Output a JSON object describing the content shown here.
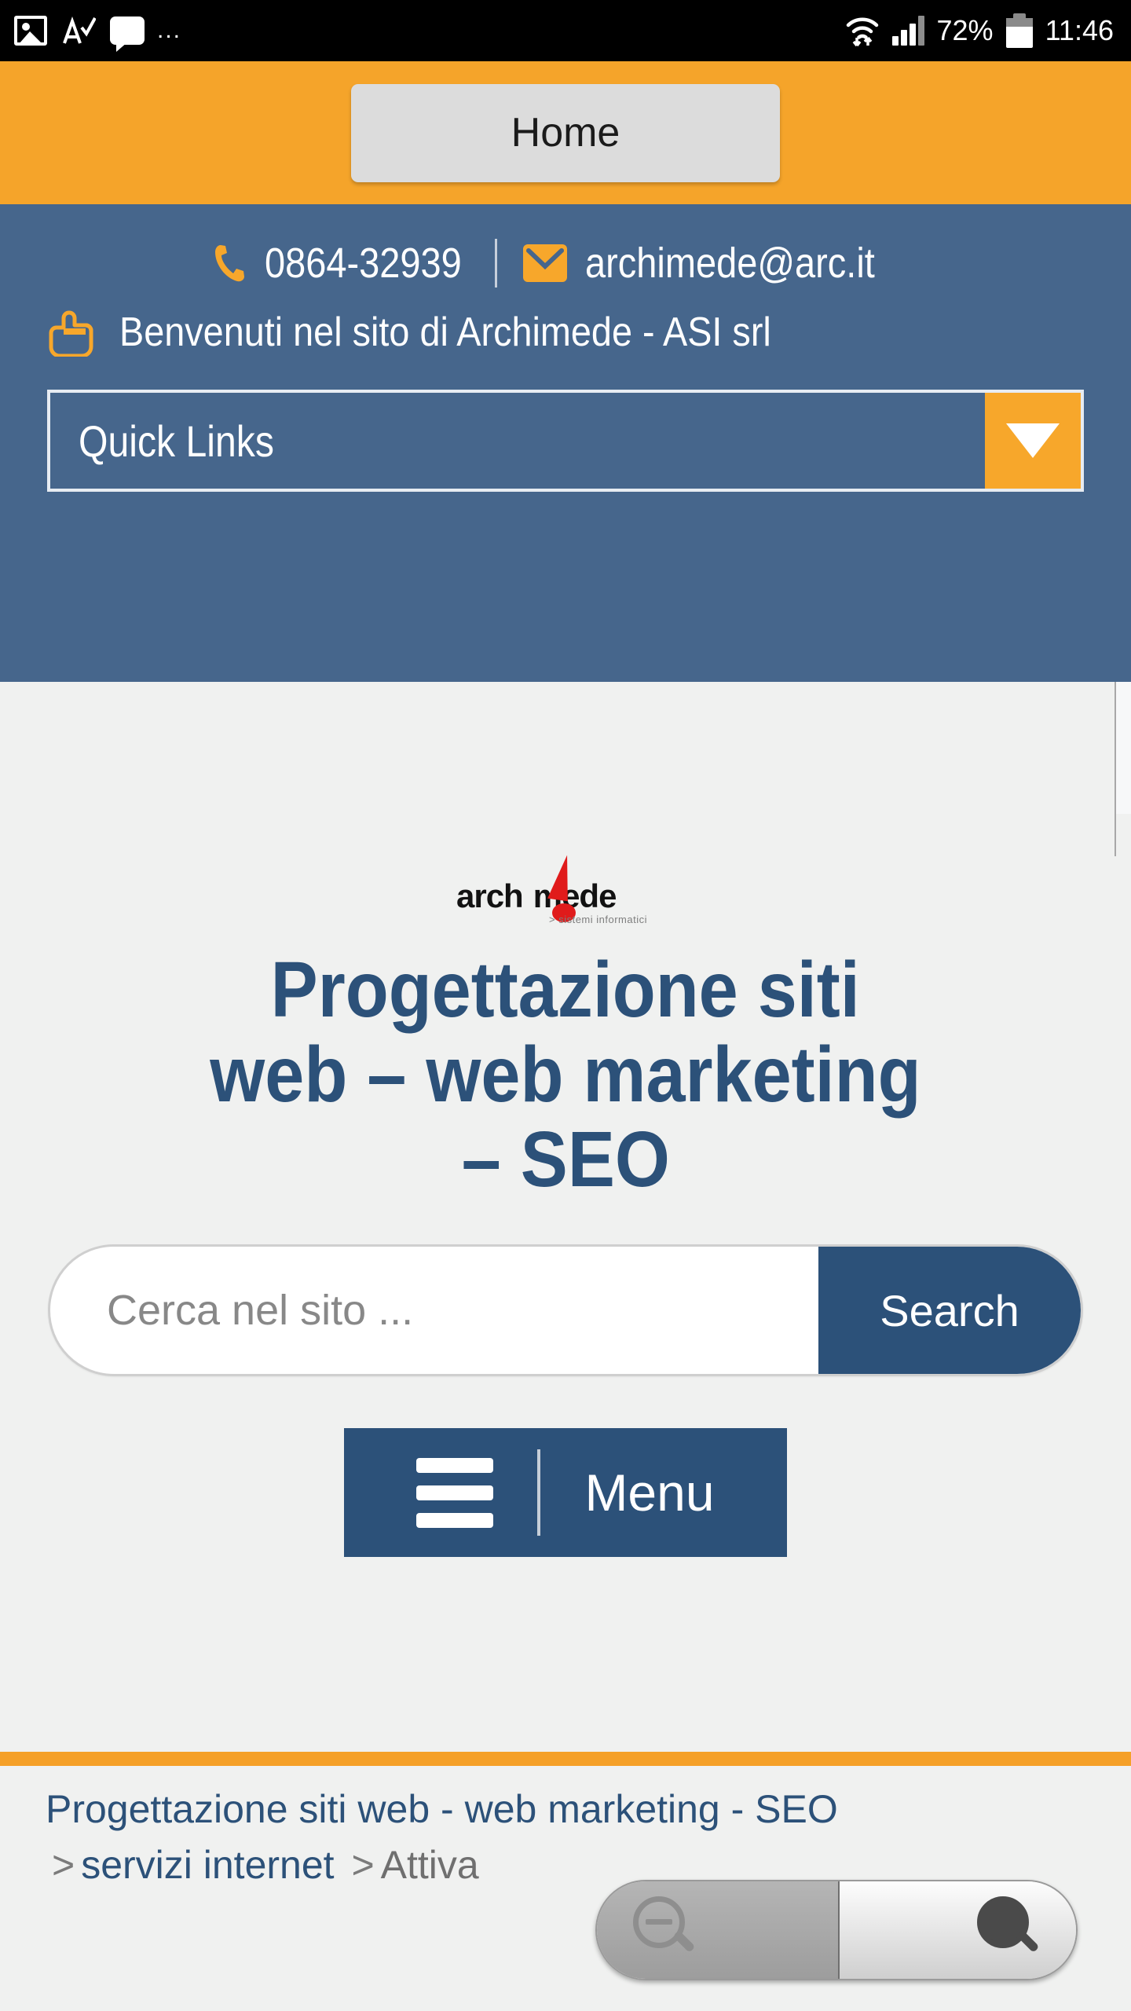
{
  "statusbar": {
    "icons": [
      "image-icon",
      "spellcheck-icon",
      "chat-icon"
    ],
    "overflow_dots": "...",
    "battery_percent": "72%",
    "time": "11:46"
  },
  "topbar": {
    "home_label": "Home"
  },
  "header": {
    "phone": "0864-32939",
    "email": "archimede@arc.it",
    "welcome": "Benvenuti nel sito di Archimede - ASI srl",
    "quick_links_label": "Quick Links"
  },
  "logo": {
    "word_left": "arch",
    "word_right": "mede",
    "tagline": "> sistemi  informatici"
  },
  "main": {
    "title_line1": "Progettazione siti",
    "title_line2": "web – web marketing",
    "title_line3": "– SEO",
    "search_placeholder": "Cerca nel sito ...",
    "search_value": "",
    "search_button": "Search",
    "menu_label": "Menu"
  },
  "breadcrumb": {
    "home": "Progettazione siti web - web marketing - SEO",
    "sep": ">",
    "level2": "servizi internet",
    "current": "Attiva"
  },
  "zoom_control": {
    "zoom_out": "zoom-out-icon",
    "zoom_in": "zoom-in-icon"
  },
  "colors": {
    "orange": "#f5a42a",
    "orange_rule": "#f5a028",
    "blue_header": "#46668c",
    "dark_blue": "#2c5179",
    "content_bg": "#f0f1f0",
    "logo_red": "#e01b1b"
  }
}
